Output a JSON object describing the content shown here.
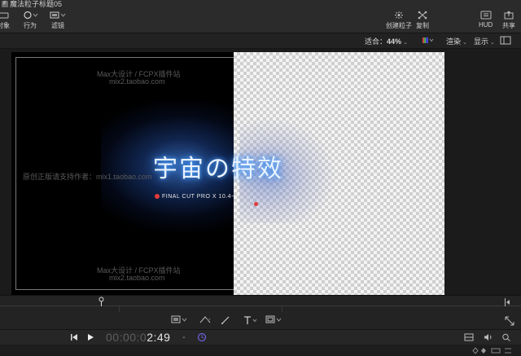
{
  "window": {
    "title": "魔法粒子标题05",
    "app_icon": "F"
  },
  "toolbar": {
    "left_items": [
      {
        "label": "对象",
        "icon": "object-icon"
      },
      {
        "label": "行为",
        "icon": "behavior-icon"
      },
      {
        "label": "滤镜",
        "icon": "filter-icon"
      }
    ],
    "right_items": [
      {
        "label": "创建粒子",
        "icon": "emitter-icon"
      },
      {
        "label": "复制",
        "icon": "replicate-icon"
      },
      {
        "label": "HUD",
        "icon": "hud-icon"
      },
      {
        "label": "共享",
        "icon": "share-icon"
      }
    ]
  },
  "viewer_header": {
    "fit_label": "适合：",
    "zoom": "44%",
    "render_label": "渲染",
    "view_label": "显示"
  },
  "canvas": {
    "watermark_top_1": "Max大设计 / FCPX插件站",
    "watermark_top_2": "mix2.taobao.com",
    "watermark_mid": "原创正版请支持作者：mix1.taobao.com",
    "watermark_bottom_1": "Max大设计 / FCPX插件站",
    "watermark_bottom_2": "mix2.taobao.com",
    "main_title": "宇宙の特效",
    "subtitle": "FINAL CUT PRO X 10.4~"
  },
  "transport": {
    "timecode_dim": "00:00:0",
    "timecode_bright": "2:49"
  },
  "colors": {
    "accent": "#5a6fd6",
    "glow": "#4fa7ff"
  }
}
